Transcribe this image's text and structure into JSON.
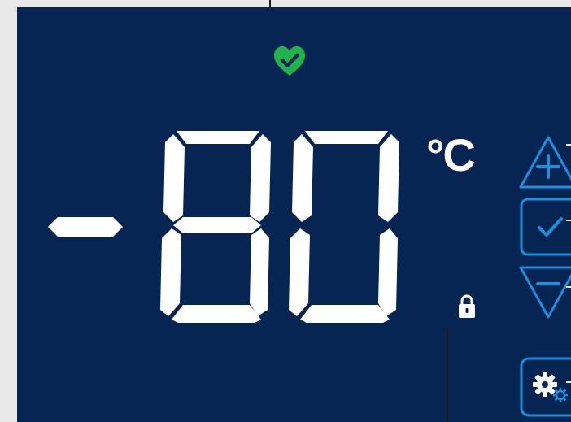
{
  "display": {
    "temperature_value": "-80",
    "temperature_unit": "°C",
    "status": "heart-check-icon",
    "lock_state": "locked"
  },
  "controls": [
    {
      "name": "increase",
      "icon": "plus-icon"
    },
    {
      "name": "confirm",
      "icon": "check-icon"
    },
    {
      "name": "decrease",
      "icon": "minus-icon"
    },
    {
      "name": "settings",
      "icon": "gears-icon"
    }
  ],
  "colors": {
    "background": "#062552",
    "segment": "#ffffff",
    "accent": "#1d8fe0",
    "status_ok": "#21b24a"
  }
}
